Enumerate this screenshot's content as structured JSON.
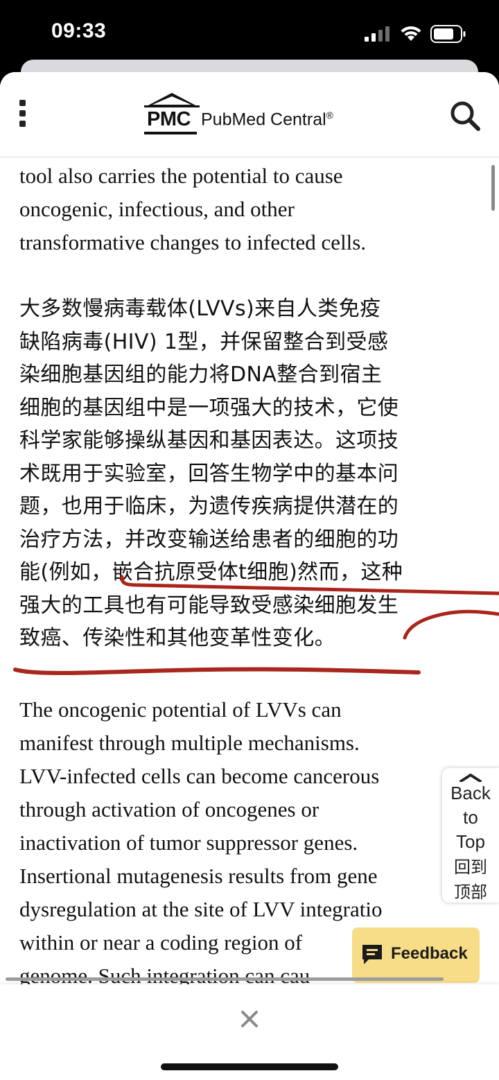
{
  "status_bar": {
    "time": "09:33",
    "icons": [
      "signal-icon",
      "wifi-icon",
      "battery-icon"
    ]
  },
  "header": {
    "logo_abbr": "PMC",
    "logo_name": "PubMed Central",
    "logo_mark": "®",
    "icons": [
      "menu-icon",
      "search-icon"
    ]
  },
  "article": {
    "para1_lines": [
      "tool also carries the potential to cause",
      "oncogenic, infectious, and other",
      "transformative changes to infected cells."
    ],
    "para_zh_lines": [
      "大多数慢病毒载体(LVVs)来自人类免疫",
      "缺陷病毒(HIV) 1型，并保留整合到受感",
      "染细胞基因组的能力将DNA整合到宿主",
      "细胞的基因组中是一项强大的技术，它使",
      "科学家能够操纵基因和基因表达。这项技",
      "术既用于实验室，回答生物学中的基本问",
      "题，也用于临床，为遗传疾病提供潜在的",
      "治疗方法，并改变输送给患者的细胞的功",
      "能(例如，嵌合抗原受体t细胞)然而，这种",
      "强大的工具也有可能导致受感染细胞发生",
      "致癌、传染性和其他变革性变化。"
    ],
    "para3_lines": [
      "The oncogenic potential of LVVs can",
      "manifest through multiple mechanisms.",
      "LVV-infected cells can become cancerous",
      "through activation of oncogenes or",
      "inactivation of tumor suppressor genes.",
      "Insertional mutagenesis results from gene",
      "dysregulation at the site of LVV integratio",
      "within or near a coding region of",
      "genome. Such integration can cau"
    ]
  },
  "back_to_top": {
    "line1": "Back",
    "line2": "to",
    "line3": "Top",
    "zh1": "回到",
    "zh2": "顶部",
    "icon": "chevron-up-icon"
  },
  "feedback": {
    "label": "Feedback",
    "icon": "chat-bubble-icon"
  },
  "bottom_bar": {
    "icon": "close-icon"
  },
  "colors": {
    "annotation_red": "#a8261b",
    "feedback_bg": "#f7dd87",
    "text": "#111111"
  }
}
